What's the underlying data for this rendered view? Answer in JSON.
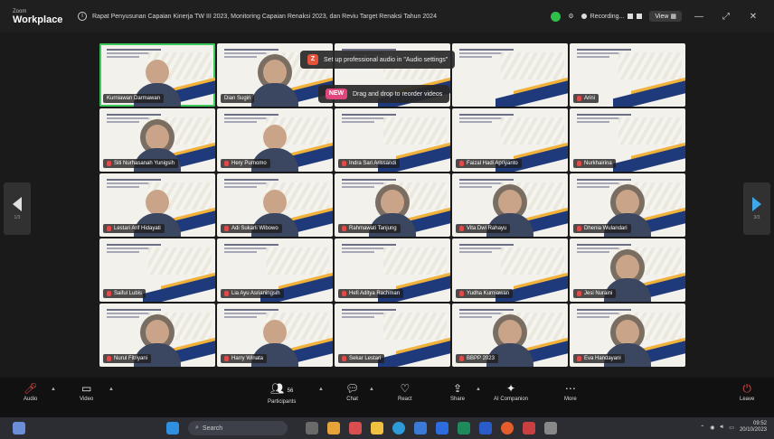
{
  "app": {
    "brand_small": "Zoom",
    "brand_big": "Workplace"
  },
  "meeting": {
    "title": "Rapat Penyusunan Capaian Kinerja TW III 2023, Monitoring Capaian Renaksi 2023, dan Reviu Target Renaksi Tahun 2024"
  },
  "titlebar": {
    "recording_label": "Recording...",
    "view_label": "View"
  },
  "toasts": [
    {
      "badge": "Z",
      "text": "Set up professional audio in \"Audio settings\""
    },
    {
      "badge": "NEW",
      "text": "Drag and drop to reorder videos"
    }
  ],
  "pager": {
    "left_label": "1/3",
    "right_label": "3/3"
  },
  "tiles": [
    {
      "name": "Kurniawan Darmawan",
      "person": true,
      "hijab": false,
      "active": true,
      "muted": false
    },
    {
      "name": "Dian Sugiri",
      "person": true,
      "hijab": true,
      "active": false,
      "muted": false
    },
    {
      "name": "",
      "person": false,
      "hijab": false,
      "active": false,
      "muted": false
    },
    {
      "name": "",
      "person": false,
      "hijab": false,
      "active": false,
      "muted": false
    },
    {
      "name": "Arini",
      "person": false,
      "hijab": false,
      "active": false,
      "muted": true
    },
    {
      "name": "Siti Nurhasanah Yunigsih",
      "person": true,
      "hijab": true,
      "active": false,
      "muted": true
    },
    {
      "name": "Hery Purnomo",
      "person": true,
      "hijab": false,
      "active": false,
      "muted": true
    },
    {
      "name": "Indra Sari Arissandi",
      "person": false,
      "hijab": false,
      "active": false,
      "muted": true
    },
    {
      "name": "Faizal Hadi Apriyanto",
      "person": false,
      "hijab": false,
      "active": false,
      "muted": true
    },
    {
      "name": "Nurkhairina",
      "person": false,
      "hijab": false,
      "active": false,
      "muted": true
    },
    {
      "name": "Lestari Arif Hidayati",
      "person": true,
      "hijab": false,
      "active": false,
      "muted": true
    },
    {
      "name": "Adi Sukarli Wibowo",
      "person": true,
      "hijab": false,
      "active": false,
      "muted": true
    },
    {
      "name": "Rahmawati Tanjung",
      "person": true,
      "hijab": true,
      "active": false,
      "muted": true
    },
    {
      "name": "Vita Dwi Rahayu",
      "person": true,
      "hijab": true,
      "active": false,
      "muted": true
    },
    {
      "name": "Dhenia Wulandari",
      "person": true,
      "hijab": true,
      "active": false,
      "muted": true
    },
    {
      "name": "Saiful Lubis",
      "person": false,
      "hijab": false,
      "active": false,
      "muted": true
    },
    {
      "name": "Lia Ayu Asrianingsih",
      "person": false,
      "hijab": false,
      "active": false,
      "muted": true
    },
    {
      "name": "Hefi Aditya Rachman",
      "person": false,
      "hijab": false,
      "active": false,
      "muted": true
    },
    {
      "name": "Yudha Kurniawan",
      "person": false,
      "hijab": false,
      "active": false,
      "muted": true
    },
    {
      "name": "Jesi Nuraini",
      "person": true,
      "hijab": true,
      "active": false,
      "muted": true
    },
    {
      "name": "Nurul Fitriyani",
      "person": true,
      "hijab": true,
      "active": false,
      "muted": true
    },
    {
      "name": "Harry Winata",
      "person": true,
      "hijab": false,
      "active": false,
      "muted": true
    },
    {
      "name": "Sekar Lestari",
      "person": false,
      "hijab": false,
      "active": false,
      "muted": true
    },
    {
      "name": "BBPP 2023",
      "person": true,
      "hijab": true,
      "active": false,
      "muted": true
    },
    {
      "name": "Eva Handayani",
      "person": true,
      "hijab": true,
      "active": false,
      "muted": true
    }
  ],
  "toolbar": {
    "audio": "Audio",
    "video": "Video",
    "participants": "Participants",
    "participants_count": "56",
    "chat": "Chat",
    "react": "React",
    "share": "Share",
    "ai_companion": "AI Companion",
    "more": "More",
    "leave": "Leave"
  },
  "taskbar": {
    "search_placeholder": "Search",
    "time": "09:52",
    "date": "20/10/2023"
  }
}
